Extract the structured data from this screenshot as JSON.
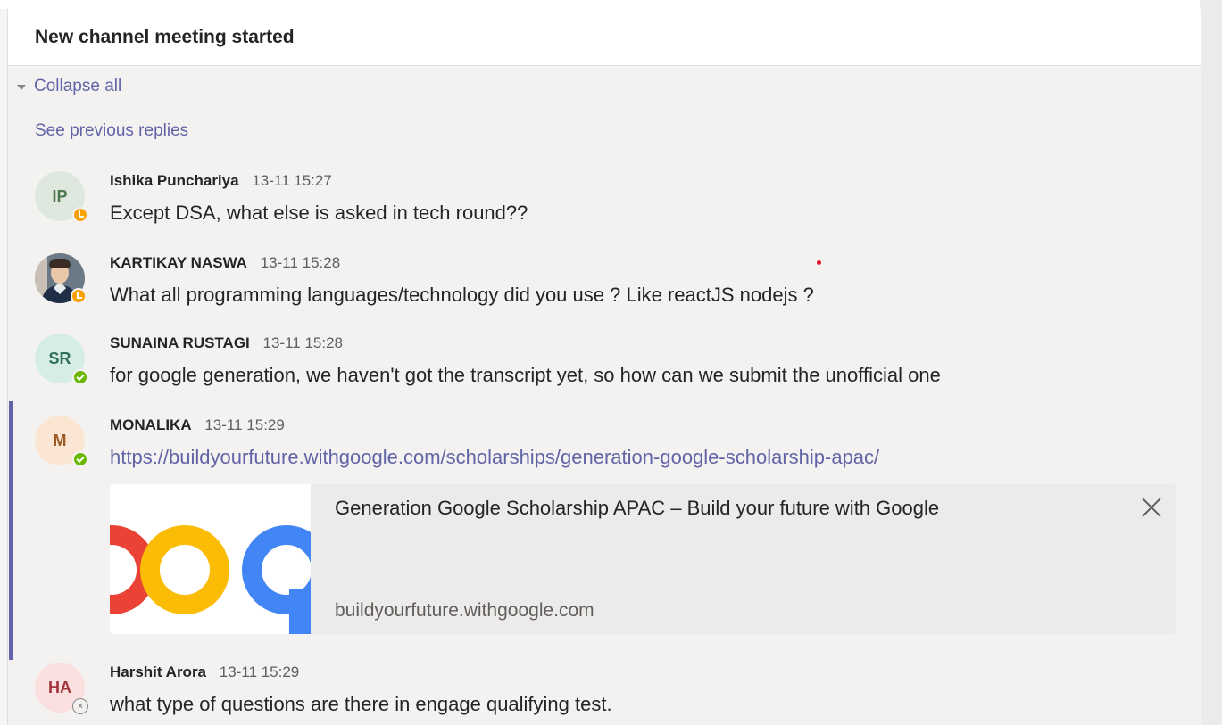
{
  "thread": {
    "title": "New channel meeting started",
    "collapse_label": "Collapse all",
    "see_previous_label": "See previous replies"
  },
  "messages": [
    {
      "author": "Ishika Punchariya",
      "time": "13-11 15:27",
      "initials": "IP",
      "avatar_bg": "#dfe8df",
      "avatar_fg": "#4c7a4c",
      "presence": "away",
      "text": "Except DSA, what else is asked in tech round??"
    },
    {
      "author": "KARTIKAY NASWA",
      "time": "13-11 15:28",
      "initials": "",
      "presence": "away",
      "text": "What all programming languages/technology did you use ? Like reactJS nodejs ?"
    },
    {
      "author": "SUNAINA RUSTAGI",
      "time": "13-11 15:28",
      "initials": "SR",
      "avatar_bg": "#d6ede5",
      "avatar_fg": "#2f6f5a",
      "presence": "available",
      "text": "for google generation, we haven't got the transcript yet, so how can we submit the unofficial one"
    },
    {
      "author": "MONALIKA",
      "time": "13-11 15:29",
      "initials": "M",
      "avatar_bg": "#fbe6d4",
      "avatar_fg": "#9a5a26",
      "presence": "available",
      "text": "https://buildyourfuture.withgoogle.com/scholarships/generation-google-scholarship-apac/",
      "card": {
        "title": "Generation Google Scholarship APAC – Build your future with Google",
        "domain": "buildyourfuture.withgoogle.com"
      }
    },
    {
      "author": "Harshit Arora",
      "time": "13-11 15:29",
      "initials": "HA",
      "avatar_bg": "#fbe0e0",
      "avatar_fg": "#a1363a",
      "presence": "offline",
      "text": "what type of questions are there in engage qualifying test."
    }
  ],
  "colors": {
    "accent": "#6264a7",
    "away": "#f8a101",
    "available": "#6bb700"
  }
}
